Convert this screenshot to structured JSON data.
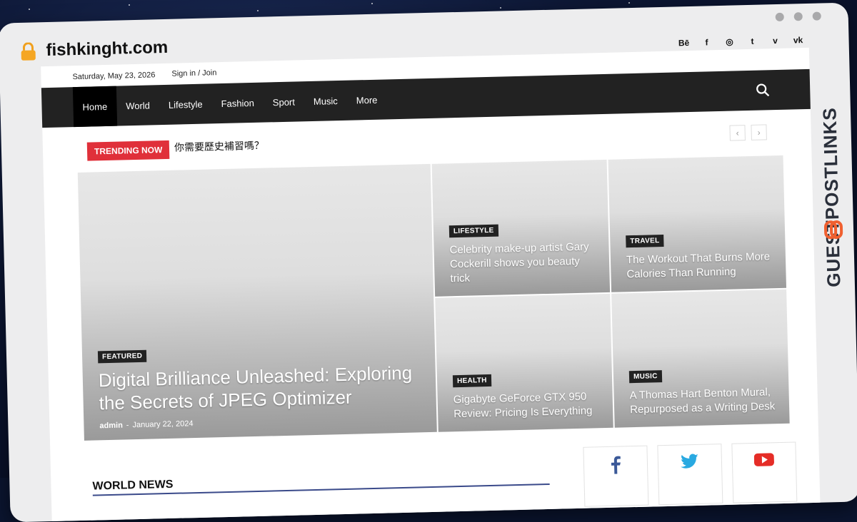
{
  "browser": {
    "domain": "fishkinght.com"
  },
  "watermark": {
    "text": "GUESTPOSTLINKS"
  },
  "topbar": {
    "date": "Saturday, May 23, 2026",
    "signin": "Sign in / Join",
    "socials": [
      "Bē",
      "f",
      "◎",
      "t",
      "v",
      "vk"
    ]
  },
  "nav": {
    "items": [
      "Home",
      "World",
      "Lifestyle",
      "Fashion",
      "Sport",
      "Music",
      "More"
    ],
    "active": "Home"
  },
  "trending": {
    "badge": "TRENDING NOW",
    "headline": "你需要歷史補習嗎？",
    "prev": "‹",
    "next": "›"
  },
  "featured": {
    "big": {
      "category": "FEATURED",
      "title": "Digital Brilliance Unleashed: Exploring the Secrets of JPEG Optimizer",
      "author": "admin",
      "separator": "-",
      "date": "January 22, 2024"
    },
    "tiles": [
      {
        "category": "LIFESTYLE",
        "title": "Celebrity make-up artist Gary Cockerill shows you beauty trick"
      },
      {
        "category": "TRAVEL",
        "title": "The Workout That Burns More Calories Than Running"
      },
      {
        "category": "HEALTH",
        "title": "Gigabyte GeForce GTX 950 Review: Pricing Is Everything"
      },
      {
        "category": "MUSIC",
        "title": "A Thomas Hart Benton Mural, Repurposed as a Writing Desk"
      }
    ]
  },
  "section": {
    "title": "WORLD NEWS"
  },
  "social_boxes": [
    {
      "icon": "facebook-icon",
      "color": "#3b5998"
    },
    {
      "icon": "twitter-icon",
      "color": "#29a9e1"
    },
    {
      "icon": "youtube-icon",
      "color": "#e52d27"
    }
  ],
  "colors": {
    "trend_badge": "#e0303a",
    "nav_bg": "#222222",
    "section_rule": "#3a4a8a"
  }
}
